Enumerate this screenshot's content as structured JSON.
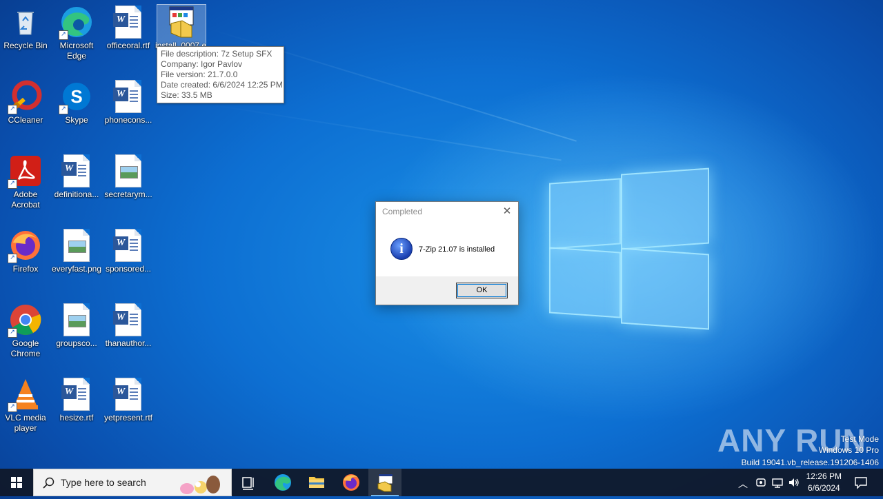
{
  "desktop": {
    "icons": [
      {
        "label": "Recycle Bin",
        "icon": "recycle-bin-icon"
      },
      {
        "label": "Microsoft Edge",
        "icon": "edge-icon"
      },
      {
        "label": "officeoral.rtf",
        "icon": "word-document-icon"
      },
      {
        "label": "install_0007.e...",
        "icon": "installer-icon"
      },
      {
        "label": "CCleaner",
        "icon": "ccleaner-icon"
      },
      {
        "label": "Skype",
        "icon": "skype-icon"
      },
      {
        "label": "phonecons...",
        "icon": "word-document-icon"
      },
      {
        "label": "Adobe Acrobat",
        "icon": "acrobat-icon"
      },
      {
        "label": "definitiona...",
        "icon": "word-document-icon"
      },
      {
        "label": "secretarym...",
        "icon": "image-file-icon"
      },
      {
        "label": "Firefox",
        "icon": "firefox-icon"
      },
      {
        "label": "everyfast.png",
        "icon": "image-file-icon"
      },
      {
        "label": "sponsored...",
        "icon": "word-document-icon"
      },
      {
        "label": "Google Chrome",
        "icon": "chrome-icon"
      },
      {
        "label": "groupsco...",
        "icon": "image-file-icon"
      },
      {
        "label": "thanauthor...",
        "icon": "word-document-icon"
      },
      {
        "label": "VLC media player",
        "icon": "vlc-icon"
      },
      {
        "label": "hesize.rtf",
        "icon": "word-document-icon"
      },
      {
        "label": "yetpresent.rtf",
        "icon": "word-document-icon"
      }
    ]
  },
  "tooltip": {
    "lines": [
      "File description: 7z Setup SFX",
      "Company: Igor Pavlov",
      "File version: 21.7.0.0",
      "Date created: 6/6/2024 12:25 PM",
      "Size: 33.5 MB"
    ]
  },
  "dialog": {
    "title": "Completed",
    "message": "7-Zip 21.07 is installed",
    "ok_label": "OK",
    "close_glyph": "✕"
  },
  "watermark": {
    "logo": "ANY RUN",
    "mode": "Test Mode",
    "edition": "Windows 10 Pro",
    "build": "Build 19041.vb_release.191206-1406"
  },
  "taskbar": {
    "search_placeholder": "Type here to search",
    "clock_time": "12:26 PM",
    "clock_date": "6/6/2024"
  },
  "colors": {
    "taskbar": "#101828",
    "accent": "#0078d7",
    "desktop_blue": "#0d6fd2"
  }
}
